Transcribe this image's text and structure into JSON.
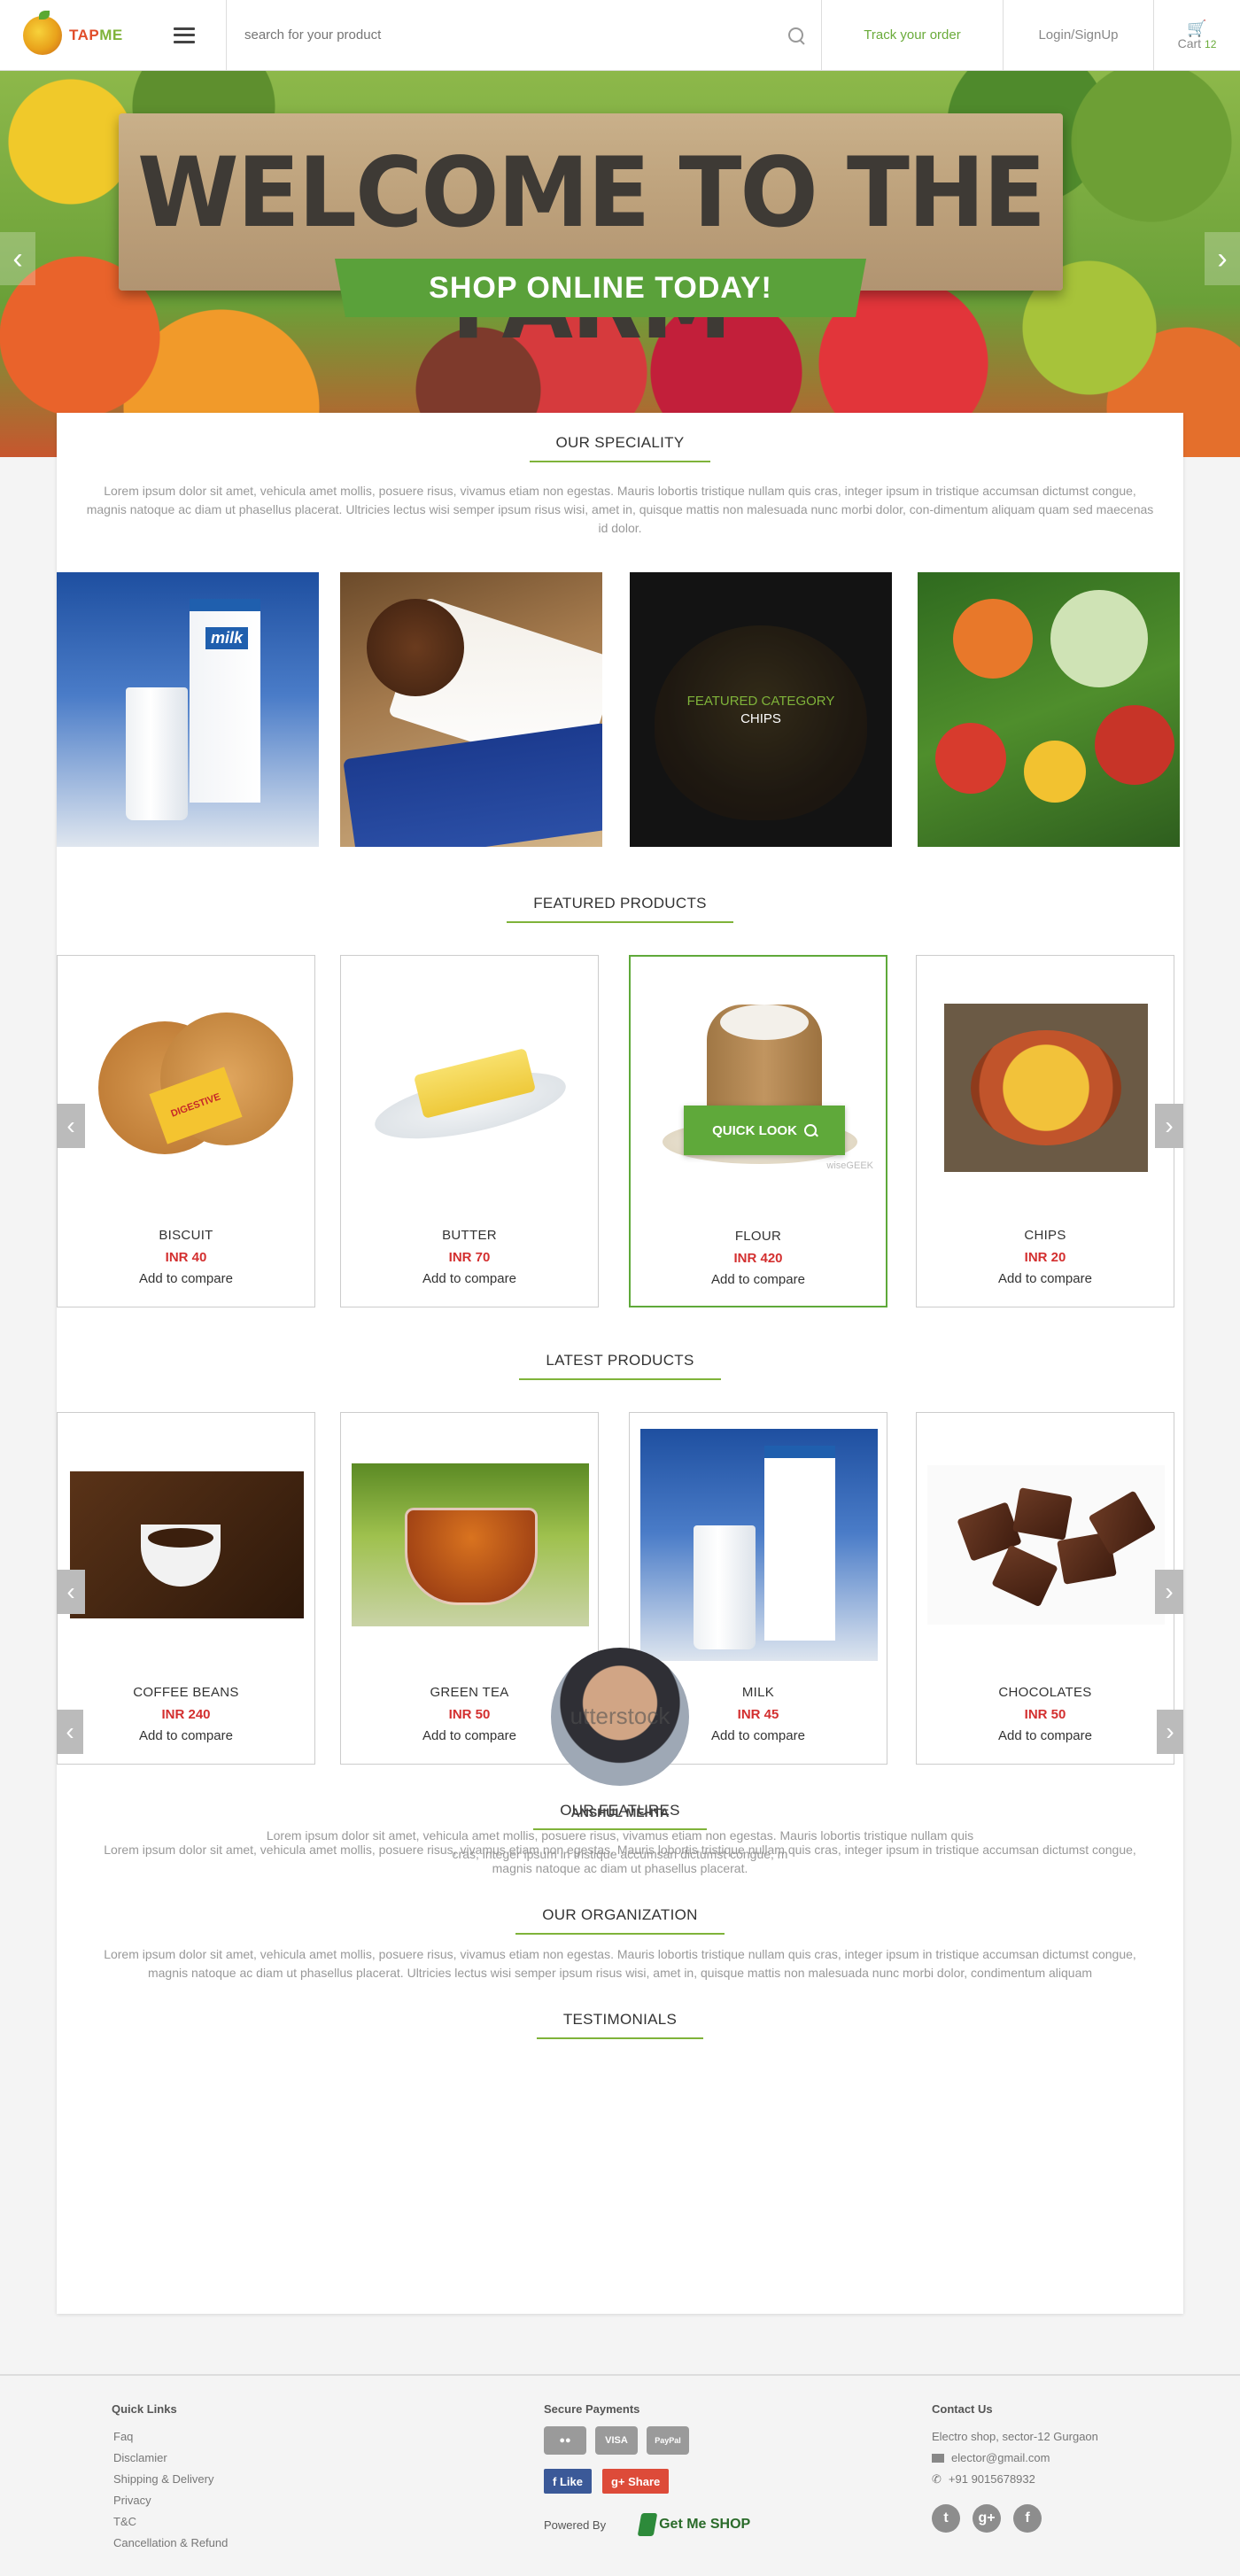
{
  "header": {
    "brand": "TAP",
    "brand_accent": "ME",
    "search_placeholder": "search for your product",
    "track_order": "Track your order",
    "login": "Login/SignUp",
    "cart_label": "Cart",
    "cart_count": "12"
  },
  "hero": {
    "title": "WELCOME TO THE FARM",
    "banner": "SHOP ONLINE TODAY!",
    "prev": "‹",
    "next": "›"
  },
  "speciality": {
    "title": "OUR SPECIALITY",
    "text": "Lorem ipsum dolor sit amet, vehicula amet mollis, posuere risus, vivamus etiam non egestas. Mauris lobortis tristique nullam quis cras, integer ipsum in tristique accumsan dictumst congue, magnis natoque ac diam ut phasellus placerat. Ultricies lectus wisi semper ipsum risus wisi, amet in, quisque mattis non malesuada nunc morbi dolor, con-dimentum aliquam quam sed maecenas id dolor.",
    "featured_label": "FEATURED CATEGORY",
    "featured_name": "CHIPS"
  },
  "featured": {
    "title": "FEATURED PRODUCTS",
    "quick_look": "QUICK LOOK",
    "watermark": "wiseGEEK",
    "biscuit_tag": "DIGESTIVE",
    "items": [
      {
        "name": "BISCUIT",
        "price": "INR 40",
        "compare": "Add to compare"
      },
      {
        "name": "BUTTER",
        "price": "INR 70",
        "compare": "Add to compare"
      },
      {
        "name": "FLOUR",
        "price": "INR 420",
        "compare": "Add to compare"
      },
      {
        "name": "CHIPS",
        "price": "INR 20",
        "compare": "Add to compare"
      }
    ]
  },
  "latest": {
    "title": "LATEST PRODUCTS",
    "items": [
      {
        "name": "COFFEE BEANS",
        "price": "INR 240",
        "compare": "Add to compare"
      },
      {
        "name": "GREEN TEA",
        "price": "INR 50",
        "compare": "Add to compare"
      },
      {
        "name": "MILK",
        "price": "INR 45",
        "compare": "Add to compare"
      },
      {
        "name": "CHOCOLATES",
        "price": "INR 50",
        "compare": "Add to compare"
      }
    ]
  },
  "features": {
    "title": "OUR FEATURES",
    "text": "Lorem ipsum dolor sit amet, vehicula amet mollis, posuere risus, vivamus etiam non egestas. Mauris lobortis tristique nullam quis cras, integer ipsum in tristique accumsan dictumst congue, magnis natoque ac diam ut phasellus placerat."
  },
  "organization": {
    "title": "OUR ORGANIZATION",
    "text": "Lorem ipsum dolor sit amet, vehicula amet mollis, posuere risus, vivamus etiam non egestas. Mauris lobortis tristique nullam quis cras, integer ipsum in tristique accumsan dictumst congue, magnis natoque ac diam ut phasellus placerat. Ultricies lectus wisi semper ipsum risus wisi, amet in, quisque mattis non malesuada nunc morbi dolor, condimentum aliquam"
  },
  "testimonials": {
    "title": "TESTIMONIALS",
    "avatar_text": "utterstock",
    "name": "ANSHUL MEHTA",
    "text": "Lorem ipsum dolor sit amet, vehicula amet mollis, posuere risus, vivamus etiam non egestas. Mauris lobortis tristique nullam quis cras, integer ipsum in tristique accumsan dictumst congue, m"
  },
  "footer": {
    "quick_links_title": "Quick Links",
    "links": [
      "Faq",
      "Disclamier",
      "Shipping & Delivery",
      "Privacy",
      "T&C",
      "Cancellation & Refund"
    ],
    "secure_title": "Secure Payments",
    "payments": [
      "VISA",
      "PayPal"
    ],
    "fb_like": "Like",
    "gp_share": "Share",
    "powered_by": "Powered By",
    "powered_logo": "Get Me SHOP",
    "contact_title": "Contact Us",
    "address": "Electro shop, sector-12 Gurgaon",
    "email": "elector@gmail.com",
    "phone": "+91 9015678932"
  }
}
